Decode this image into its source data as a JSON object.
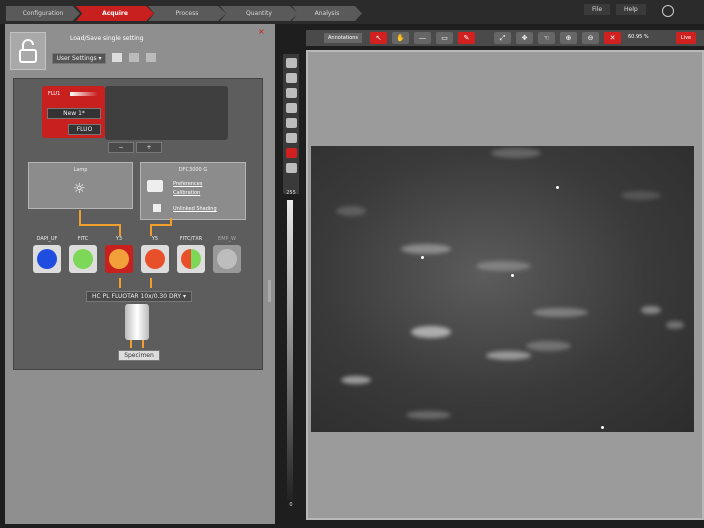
{
  "workflow": {
    "tabs": [
      {
        "label": "Configuration",
        "active": false
      },
      {
        "label": "Acquire",
        "active": true
      },
      {
        "label": "Process",
        "active": false
      },
      {
        "label": "Quantity",
        "active": false
      },
      {
        "label": "Analysis",
        "active": false
      }
    ]
  },
  "menu": {
    "file": "File",
    "help": "Help"
  },
  "settings": {
    "title": "Load/Save single setting",
    "dropdown": "User Settings",
    "close": "×"
  },
  "fluo_panel": {
    "name": "FLU1",
    "new_value": "New 1*",
    "mode": "FLUO",
    "minus": "−",
    "plus": "+"
  },
  "lamp": {
    "label": "Lamp"
  },
  "camera": {
    "title": "DFC3000 G",
    "preferences": "Preferences",
    "calibration": "Calibration",
    "unlinked": "Unlinked Shading"
  },
  "filters": [
    {
      "label": "DAPI_UF",
      "color": "#1f4de0"
    },
    {
      "label": "FITC",
      "color": "#7dd85a"
    },
    {
      "label": "Y3",
      "color": "#f2a13a"
    },
    {
      "label": "Y5",
      "color": "#e8502a"
    },
    {
      "label": "FITC/TXR",
      "color": "split"
    },
    {
      "label": "EMP_W",
      "color": "#bdbdbd"
    }
  ],
  "objective": {
    "label": "HC PL FLUOTAR 10x/0.30 DRY"
  },
  "specimen": {
    "label": "Specimen"
  },
  "viewer_toolbar": {
    "annotations": "Annotations",
    "zoom": "60.95 %",
    "live": "Live"
  },
  "slider": {
    "top_value": "255",
    "bottom_value": "0"
  },
  "colors": {
    "accent": "#c8201f",
    "orange": "#f0a02a"
  }
}
